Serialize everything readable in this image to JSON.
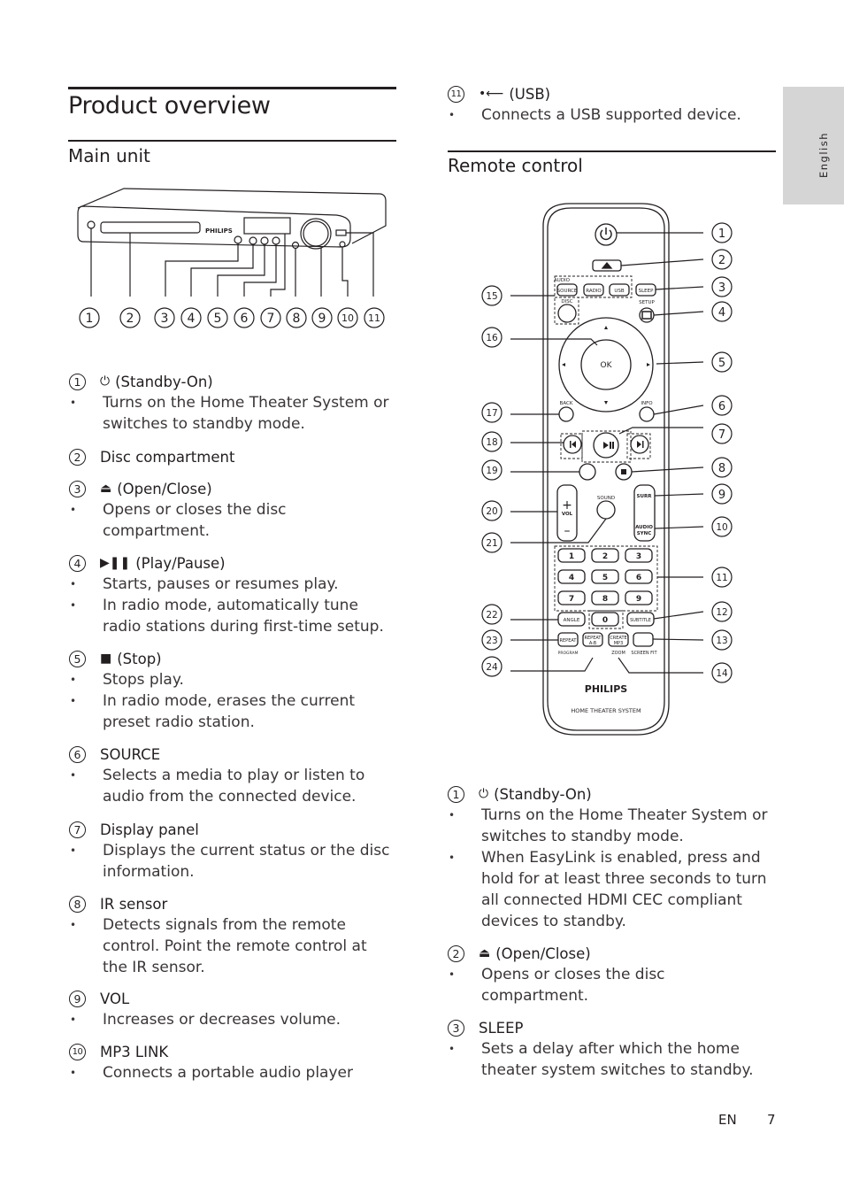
{
  "page": {
    "title": "Product overview",
    "language_tab": "English",
    "footer": {
      "lang": "EN",
      "page_number": "7"
    }
  },
  "main_unit": {
    "heading": "Main unit",
    "diagram": {
      "brand": "PHILIPS",
      "callouts": [
        "1",
        "2",
        "3",
        "4",
        "5",
        "6",
        "7",
        "8",
        "9",
        "10",
        "11"
      ]
    },
    "items": [
      {
        "num": "1",
        "icon": "power-icon",
        "glyph": "⏻",
        "title": "(Standby-On)",
        "bullets": [
          "Turns on the Home Theater System or switches to standby mode."
        ]
      },
      {
        "num": "2",
        "title": "Disc compartment",
        "bullets": []
      },
      {
        "num": "3",
        "icon": "eject-icon",
        "glyph": "⏏",
        "title": "(Open/Close)",
        "bullets": [
          "Opens or closes the disc compartment."
        ]
      },
      {
        "num": "4",
        "icon": "play-pause-icon",
        "glyph": "▶❚❚",
        "title": "(Play/Pause)",
        "bullets": [
          "Starts, pauses or resumes play.",
          "In radio mode, automatically tune radio stations during first-time setup."
        ]
      },
      {
        "num": "5",
        "icon": "stop-icon",
        "glyph": "■",
        "title": "(Stop)",
        "bullets": [
          "Stops play.",
          "In radio mode, erases the current preset radio station."
        ]
      },
      {
        "num": "6",
        "title": "SOURCE",
        "bullets": [
          "Selects a media to play or listen to audio from the connected device."
        ]
      },
      {
        "num": "7",
        "title": "Display panel",
        "bullets": [
          "Displays the current status or the disc information."
        ]
      },
      {
        "num": "8",
        "title": "IR sensor",
        "bullets": [
          "Detects signals from the remote control. Point the remote control at the IR sensor."
        ]
      },
      {
        "num": "9",
        "title": "VOL",
        "bullets": [
          "Increases or decreases volume."
        ]
      },
      {
        "num": "10",
        "title": "MP3 LINK",
        "bullets": [
          "Connects a portable audio player"
        ]
      },
      {
        "num": "11",
        "icon": "usb-icon",
        "glyph": "•⟵",
        "title": "(USB)",
        "bullets": [
          "Connects a USB supported device."
        ]
      }
    ]
  },
  "remote_control": {
    "heading": "Remote control",
    "diagram": {
      "brand": "PHILIPS",
      "model_text": "HOME THEATER SYSTEM",
      "button_labels": {
        "audio": "AUDIO",
        "source": "SOURCE",
        "radio": "RADIO",
        "usb": "USB",
        "sleep": "SLEEP",
        "setup": "SETUP",
        "disc": "DISC",
        "ok": "OK",
        "back": "BACK",
        "info": "INFO",
        "sound": "SOUND",
        "vol": "VOL",
        "surr": "SURR",
        "audio_sync_1": "AUDIO",
        "audio_sync_2": "SYNC",
        "angle": "ANGLE",
        "subtitle": "SUBTITLE",
        "repeat": "REPEAT",
        "program": "PROGRAM",
        "repeat_ab_1": "REPEAT",
        "repeat_ab_2": "A-B",
        "create_mp3_1": "CREATE",
        "create_mp3_2": "MP3",
        "zoom": "ZOOM",
        "screen_fit": "SCREEN FIT"
      },
      "digits": [
        "1",
        "2",
        "3",
        "4",
        "5",
        "6",
        "7",
        "8",
        "9",
        "0"
      ],
      "callouts_right": [
        "1",
        "2",
        "3",
        "4",
        "5",
        "6",
        "7",
        "8",
        "9",
        "10",
        "11",
        "12",
        "13",
        "14"
      ],
      "callouts_left": [
        "15",
        "16",
        "17",
        "18",
        "19",
        "20",
        "21",
        "22",
        "23",
        "24"
      ]
    },
    "items": [
      {
        "num": "1",
        "icon": "power-icon",
        "glyph": "⏻",
        "title": "(Standby-On)",
        "bullets": [
          "Turns on the Home Theater System or switches to standby mode.",
          "When EasyLink is enabled, press and hold for at least three seconds to turn all connected HDMI CEC compliant devices to standby."
        ]
      },
      {
        "num": "2",
        "icon": "eject-icon",
        "glyph": "⏏",
        "title": "(Open/Close)",
        "bullets": [
          "Opens or closes the disc compartment."
        ]
      },
      {
        "num": "3",
        "title": "SLEEP",
        "bullets": [
          "Sets a delay after which the home theater system switches to standby."
        ]
      }
    ]
  }
}
